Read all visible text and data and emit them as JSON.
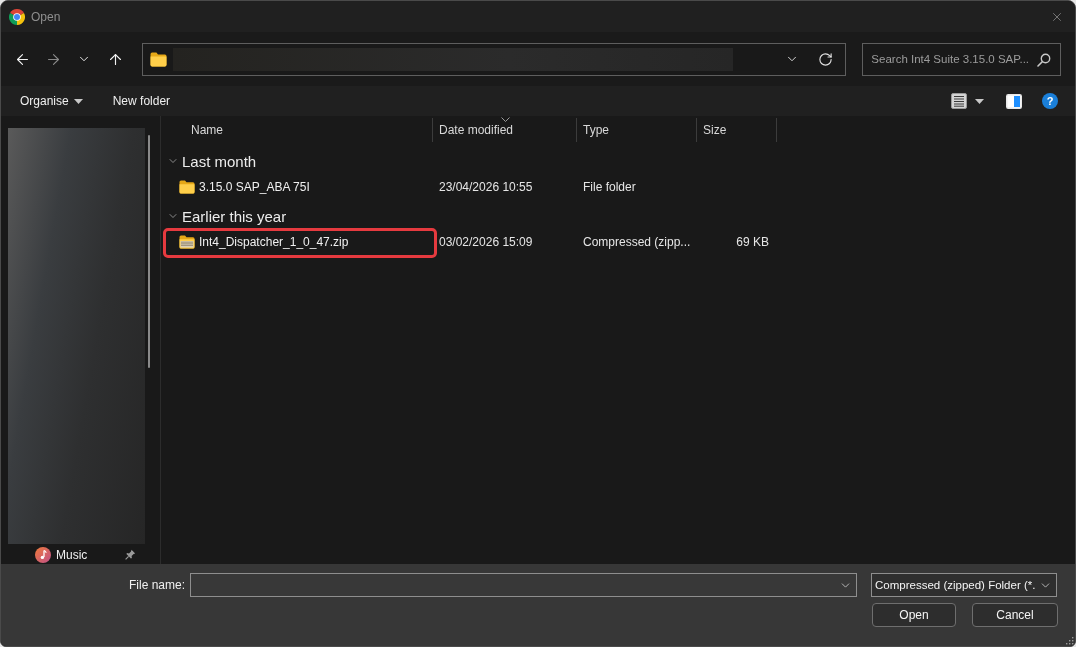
{
  "window": {
    "title": "Open"
  },
  "navigation": {
    "buttons": [
      {
        "kind": "back",
        "disabled": false
      },
      {
        "kind": "forward",
        "disabled": true
      },
      {
        "kind": "recent",
        "disabled": false
      },
      {
        "kind": "up",
        "disabled": false
      }
    ]
  },
  "search": {
    "placeholder": "Search Int4 Suite 3.15.0 SAP..."
  },
  "command_bar": {
    "items": [
      {
        "kind": "menu",
        "label": "Organise"
      },
      {
        "kind": "action",
        "label": "New folder"
      }
    ],
    "help_symbol": "?"
  },
  "sidebar": {
    "items": [
      {
        "label": "Music",
        "pinned": true
      }
    ]
  },
  "file_list": {
    "columns": [
      {
        "label": "Name",
        "sorted": false
      },
      {
        "label": "Date modified",
        "sorted": true
      },
      {
        "label": "Type",
        "sorted": false
      },
      {
        "label": "Size",
        "sorted": false
      }
    ],
    "groups": [
      {
        "label": "Last month",
        "expanded": true,
        "rows": [
          {
            "kind": "folder",
            "name": "3.15.0 SAP_ABA 75I",
            "date_modified": "23/04/2026 10:55",
            "type": "File folder",
            "selected": false,
            "highlighted": false
          }
        ]
      },
      {
        "label": "Earlier this year",
        "expanded": true,
        "rows": [
          {
            "kind": "zip",
            "name": "Int4_Dispatcher_1_0_47.zip",
            "date_modified": "03/02/2026 15:09",
            "type": "Compressed (zipp...",
            "size": "69 KB",
            "selected": false,
            "highlighted": true
          }
        ]
      }
    ]
  },
  "footer": {
    "file_name_label": "File name:",
    "file_type": "Compressed (zipped) Folder (*.",
    "buttons": [
      "Open",
      "Cancel"
    ]
  }
}
